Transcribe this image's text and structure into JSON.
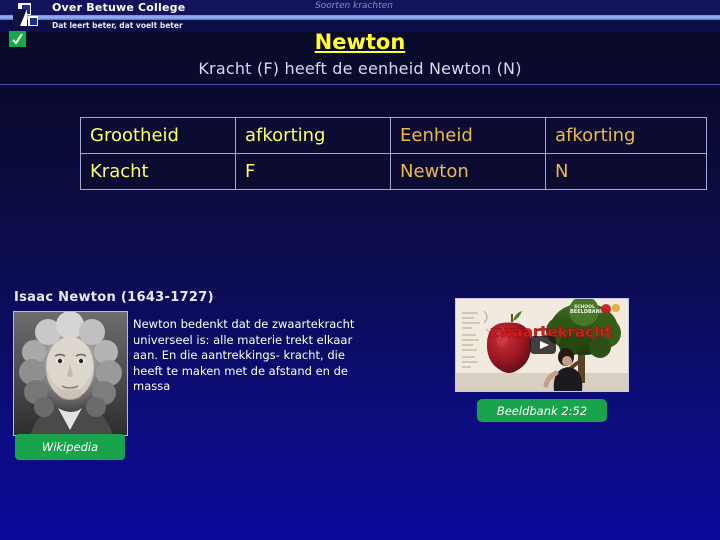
{
  "header": {
    "school_name": "Over Betuwe College",
    "tagline": "Dat leert beter, dat voelt beter",
    "topic": "Soorten krachten"
  },
  "slide": {
    "title": "Newton",
    "subtitle": "Kracht (F) heeft de eenheid Newton (N)"
  },
  "table": {
    "headers": [
      "Grootheid",
      "afkorting",
      "Eenheid",
      "afkorting"
    ],
    "rows": [
      [
        "Kracht",
        "F",
        "Newton",
        "N"
      ]
    ]
  },
  "newton": {
    "heading": "Isaac Newton (1643-1727)",
    "body": "Newton bedenkt dat de zwaartekracht universeel is: alle materie trekt elkaar aan. En die aantrekkings- kracht, die heeft te maken met de afstand en de massa",
    "wikipedia_label": "Wikipedia"
  },
  "video": {
    "overlay_title": "zwaartekracht",
    "watermark": "BEELDBANK",
    "caption": "Beeldbank 2:52"
  },
  "colors": {
    "accent_yellow": "#ffff33",
    "table_yellow": "#ffff66",
    "table_gold": "#edb84f",
    "button_green": "#18a34c",
    "background_top": "#0a0a22",
    "background_bottom": "#0a0a9c"
  }
}
